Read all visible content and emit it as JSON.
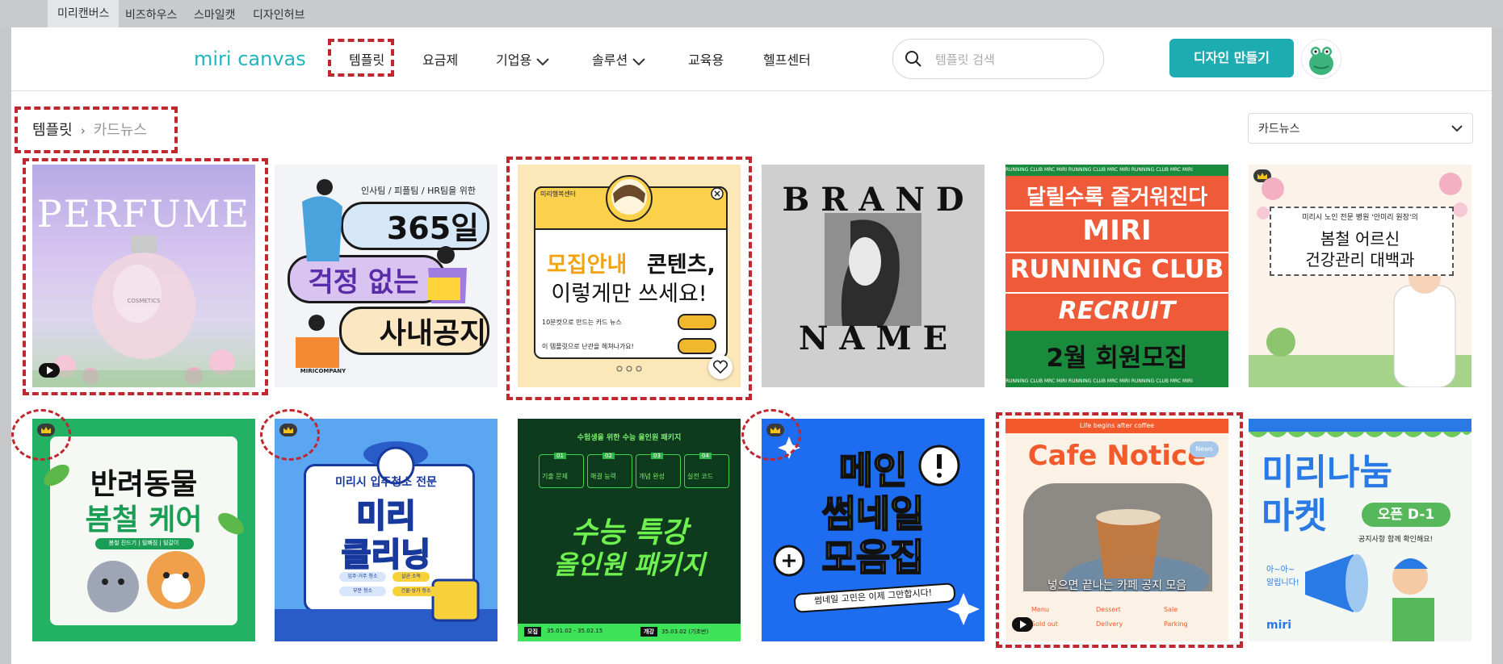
{
  "topbar": {
    "links": [
      "미리캔버스",
      "비즈하우스",
      "스마일캣",
      "디자인허브"
    ]
  },
  "header": {
    "logo_text": "miri canvas",
    "nav": [
      "템플릿",
      "요금제",
      "기업용",
      "솔루션",
      "교육용",
      "헬프센터"
    ],
    "search_placeholder": "템플릿 검색",
    "create_button": "디자인 만들기"
  },
  "breadcrumb": {
    "root": "템플릿",
    "separator": "›",
    "current": "카드뉴스"
  },
  "category_select": {
    "value": "카드뉴스"
  },
  "cards": [
    {
      "id": "perfume",
      "lines": [
        "PERFUME"
      ],
      "small": "COSMETICS"
    },
    {
      "id": "notice365",
      "lines": [
        "인사팀 / 피플팀 / HR팀을 위한",
        "365일",
        "걱정 없는",
        "사내공지",
        "MIRICOMPANY"
      ]
    },
    {
      "id": "recruit-content",
      "lines": [
        "미리행복센터",
        "모집안내",
        "콘텐츠,",
        "이렇게만 쓰세요!",
        "10분컷으로 만드는 카드 뉴스",
        "이 템플릿으로 난관을 헤쳐나가요!"
      ]
    },
    {
      "id": "brand-name",
      "lines": [
        "B R A N D",
        "N A M E"
      ]
    },
    {
      "id": "running-club",
      "lines": [
        "달릴수록 즐거워진다",
        "MIRI",
        "RUNNING CLUB",
        "RECRUIT",
        "2월 회원모집"
      ],
      "ticker": "RUNNING CLUB  MRC  MIRI RUNNING CLUB  MRC  MIRI RUNNING CLUB  MRC  MIRI"
    },
    {
      "id": "senior-health",
      "lines": [
        "미리시 노인 전문 병원 '안미리 원장'의",
        "봄철 어르신",
        "건강관리 대백과"
      ]
    },
    {
      "id": "pet-care",
      "lines": [
        "반려동물",
        "봄철 케어",
        "봄철 진드기 | 털빠짐 | 털갈이"
      ]
    },
    {
      "id": "cleaning",
      "lines": [
        "미리시 입주청소 전문",
        "미리",
        "클리닝",
        "입주·거주 청소",
        "살균 소독",
        "부분 청소",
        "건물·상가 청소"
      ]
    },
    {
      "id": "suneung",
      "lines": [
        "수험생을 위한 수능 올인원 패키지",
        "01",
        "02",
        "03",
        "04",
        "기출 문제",
        "해결 능력",
        "개념 완성",
        "실전 코드",
        "수능 특강",
        "올인원 패키지",
        "모집",
        "35.01.02 - 35.02.15",
        "개강",
        "35.03.02 (기초반)"
      ]
    },
    {
      "id": "thumbnail",
      "lines": [
        "메인",
        "썸네일",
        "모음집",
        "썸네일 고민은 이제 그만합시다!"
      ]
    },
    {
      "id": "cafe",
      "lines": [
        "Life begins after coffee",
        "Cafe Notice",
        "News",
        "넣으면 끝나는 카페 공지 모음",
        "Menu",
        "Dessert",
        "Sale",
        "Sold out",
        "Delivery",
        "Parking"
      ]
    },
    {
      "id": "market",
      "lines": [
        "미리나눔",
        "마켓",
        "오픈 D-1",
        "공지사항 함께 확인해요!",
        "아~아~",
        "알립니다!",
        "miri"
      ]
    }
  ],
  "colors": {
    "accent": "#1eacb3",
    "highlight": "#c0282f"
  }
}
